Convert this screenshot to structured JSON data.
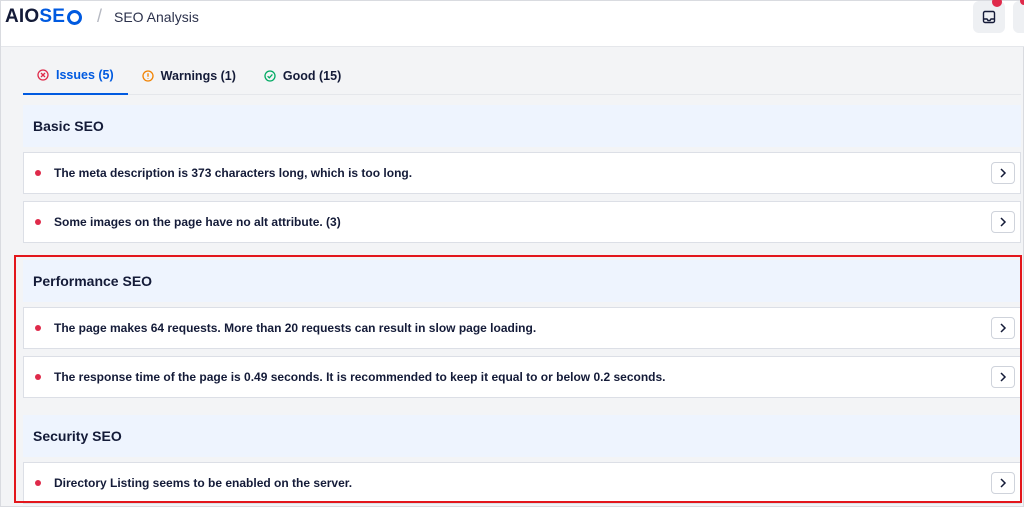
{
  "header": {
    "logo_aio": "AIO",
    "logo_seo": "SE",
    "separator": "/",
    "title": "SEO Analysis"
  },
  "tabs": [
    {
      "label": "Issues (5)",
      "icon": "x-circle-icon",
      "color": "#df2a4a",
      "active": true
    },
    {
      "label": "Warnings (1)",
      "icon": "info-circle-icon",
      "color": "#f18200",
      "active": false
    },
    {
      "label": "Good (15)",
      "icon": "check-circle-icon",
      "color": "#00aa63",
      "active": false
    }
  ],
  "sections": [
    {
      "title": "Basic SEO",
      "items": [
        "The meta description is 373 characters long, which is too long.",
        "Some images on the page have no alt attribute. (3)"
      ]
    },
    {
      "title": "Performance SEO",
      "items": [
        "The page makes 64 requests. More than 20 requests can result in slow page loading.",
        "The response time of the page is 0.49 seconds. It is recommended to keep it equal to or below 0.2 seconds."
      ]
    },
    {
      "title": "Security SEO",
      "items": [
        "Directory Listing seems to be enabled on the server."
      ]
    }
  ],
  "colors": {
    "accent": "#005ae0",
    "issue": "#df2a4a",
    "highlight_border": "#e3161b",
    "section_bg": "#eef4fe"
  }
}
